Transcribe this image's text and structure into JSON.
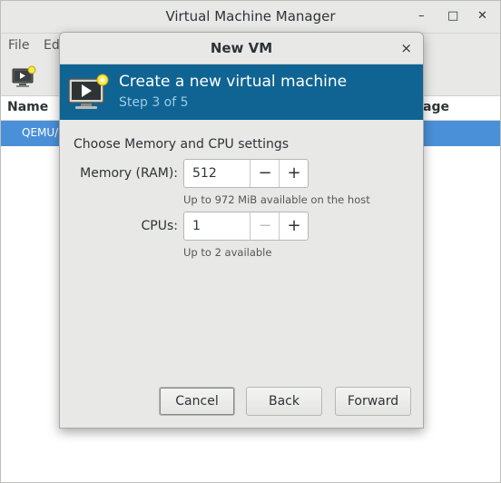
{
  "main_window": {
    "title": "Virtual Machine Manager",
    "controls": {
      "minimize": "–",
      "maximize": "□",
      "close": "✕"
    },
    "menu": {
      "file": "File",
      "edit": "Ed"
    },
    "columns": {
      "name": "Name",
      "usage": "age"
    },
    "selected_row": "QEMU/K"
  },
  "dialog": {
    "title": "New VM",
    "close": "×",
    "banner": {
      "title": "Create a new virtual machine",
      "step": "Step 3 of 5"
    },
    "section_heading": "Choose Memory and CPU settings",
    "memory": {
      "label": "Memory (RAM):",
      "value": "512",
      "decrement": "−",
      "increment": "+",
      "hint": "Up to 972 MiB available on the host"
    },
    "cpus": {
      "label": "CPUs:",
      "value": "1",
      "decrement": "−",
      "increment": "+",
      "hint": "Up to 2 available"
    },
    "buttons": {
      "cancel": "Cancel",
      "back": "Back",
      "forward": "Forward"
    }
  },
  "colors": {
    "banner": "#0f6493",
    "selection": "#4a90d9",
    "window_bg": "#e8e8e7"
  }
}
